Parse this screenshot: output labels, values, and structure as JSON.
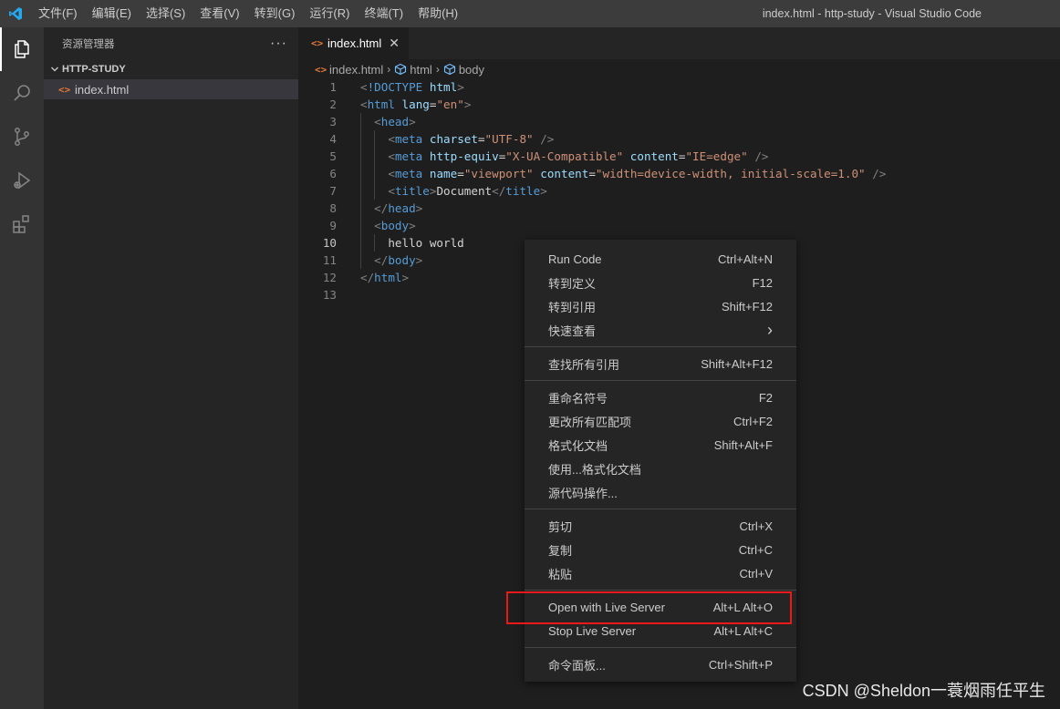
{
  "titlebar": {
    "menu": [
      "文件(F)",
      "编辑(E)",
      "选择(S)",
      "查看(V)",
      "转到(G)",
      "运行(R)",
      "终端(T)",
      "帮助(H)"
    ],
    "window_title": "index.html - http-study - Visual Studio Code"
  },
  "activitybar": {
    "icons": [
      "explorer-icon",
      "search-icon",
      "source-control-icon",
      "run-debug-icon",
      "extensions-icon"
    ]
  },
  "sidebar": {
    "title": "资源管理器",
    "more": "···",
    "folder": "HTTP-STUDY",
    "files": [
      {
        "icon": "<>",
        "name": "index.html"
      }
    ]
  },
  "editor": {
    "tab": {
      "icon": "<>",
      "name": "index.html",
      "close": "✕"
    },
    "breadcrumbs": [
      "index.html",
      "html",
      "body"
    ],
    "line_numbers": [
      "1",
      "2",
      "3",
      "4",
      "5",
      "6",
      "7",
      "8",
      "9",
      "10",
      "11",
      "12",
      "13"
    ],
    "current_line": "10",
    "lines": [
      {
        "indent": 0,
        "tokens": [
          [
            "punc",
            "<"
          ],
          [
            "tag",
            "!DOCTYPE"
          ],
          [
            "text",
            " "
          ],
          [
            "attr",
            "html"
          ],
          [
            "punc",
            ">"
          ]
        ]
      },
      {
        "indent": 0,
        "tokens": [
          [
            "punc",
            "<"
          ],
          [
            "tag",
            "html"
          ],
          [
            "text",
            " "
          ],
          [
            "attr",
            "lang"
          ],
          [
            "text",
            "="
          ],
          [
            "str",
            "\"en\""
          ],
          [
            "punc",
            ">"
          ]
        ]
      },
      {
        "indent": 1,
        "tokens": [
          [
            "punc",
            "<"
          ],
          [
            "tag",
            "head"
          ],
          [
            "punc",
            ">"
          ]
        ]
      },
      {
        "indent": 2,
        "tokens": [
          [
            "punc",
            "<"
          ],
          [
            "tag",
            "meta"
          ],
          [
            "text",
            " "
          ],
          [
            "attr",
            "charset"
          ],
          [
            "text",
            "="
          ],
          [
            "str",
            "\"UTF-8\""
          ],
          [
            "text",
            " "
          ],
          [
            "punc",
            "/>"
          ]
        ]
      },
      {
        "indent": 2,
        "tokens": [
          [
            "punc",
            "<"
          ],
          [
            "tag",
            "meta"
          ],
          [
            "text",
            " "
          ],
          [
            "attr",
            "http-equiv"
          ],
          [
            "text",
            "="
          ],
          [
            "str",
            "\"X-UA-Compatible\""
          ],
          [
            "text",
            " "
          ],
          [
            "attr",
            "content"
          ],
          [
            "text",
            "="
          ],
          [
            "str",
            "\"IE=edge\""
          ],
          [
            "text",
            " "
          ],
          [
            "punc",
            "/>"
          ]
        ]
      },
      {
        "indent": 2,
        "tokens": [
          [
            "punc",
            "<"
          ],
          [
            "tag",
            "meta"
          ],
          [
            "text",
            " "
          ],
          [
            "attr",
            "name"
          ],
          [
            "text",
            "="
          ],
          [
            "str",
            "\"viewport\""
          ],
          [
            "text",
            " "
          ],
          [
            "attr",
            "content"
          ],
          [
            "text",
            "="
          ],
          [
            "str",
            "\"width=device-width, initial-scale=1.0\""
          ],
          [
            "text",
            " "
          ],
          [
            "punc",
            "/>"
          ]
        ]
      },
      {
        "indent": 2,
        "tokens": [
          [
            "punc",
            "<"
          ],
          [
            "tag",
            "title"
          ],
          [
            "punc",
            ">"
          ],
          [
            "text",
            "Document"
          ],
          [
            "punc",
            "</"
          ],
          [
            "tag",
            "title"
          ],
          [
            "punc",
            ">"
          ]
        ]
      },
      {
        "indent": 1,
        "tokens": [
          [
            "punc",
            "</"
          ],
          [
            "tag",
            "head"
          ],
          [
            "punc",
            ">"
          ]
        ]
      },
      {
        "indent": 1,
        "tokens": [
          [
            "punc",
            "<"
          ],
          [
            "tag",
            "body"
          ],
          [
            "punc",
            ">"
          ]
        ]
      },
      {
        "indent": 2,
        "tokens": [
          [
            "text",
            "hello world"
          ]
        ]
      },
      {
        "indent": 1,
        "tokens": [
          [
            "punc",
            "</"
          ],
          [
            "tag",
            "body"
          ],
          [
            "punc",
            ">"
          ]
        ]
      },
      {
        "indent": 0,
        "tokens": [
          [
            "punc",
            "</"
          ],
          [
            "tag",
            "html"
          ],
          [
            "punc",
            ">"
          ]
        ]
      },
      {
        "indent": 0,
        "tokens": []
      }
    ]
  },
  "context_menu": {
    "groups": [
      [
        {
          "label": "Run Code",
          "key": "Ctrl+Alt+N"
        },
        {
          "label": "转到定义",
          "key": "F12"
        },
        {
          "label": "转到引用",
          "key": "Shift+F12"
        },
        {
          "label": "快速查看",
          "key": "›"
        }
      ],
      [
        {
          "label": "查找所有引用",
          "key": "Shift+Alt+F12"
        }
      ],
      [
        {
          "label": "重命名符号",
          "key": "F2"
        },
        {
          "label": "更改所有匹配项",
          "key": "Ctrl+F2"
        },
        {
          "label": "格式化文档",
          "key": "Shift+Alt+F"
        },
        {
          "label": "使用...格式化文档",
          "key": ""
        },
        {
          "label": "源代码操作...",
          "key": ""
        }
      ],
      [
        {
          "label": "剪切",
          "key": "Ctrl+X"
        },
        {
          "label": "复制",
          "key": "Ctrl+C"
        },
        {
          "label": "粘贴",
          "key": "Ctrl+V"
        }
      ],
      [
        {
          "label": "Open with Live Server",
          "key": "Alt+L Alt+O"
        },
        {
          "label": "Stop Live Server",
          "key": "Alt+L Alt+C"
        }
      ],
      [
        {
          "label": "命令面板...",
          "key": "Ctrl+Shift+P"
        }
      ]
    ],
    "highlighted": "Open with Live Server"
  },
  "colors": {
    "highlight_border": "#e8191b",
    "html_icon": "#e37933",
    "vscode_blue": "#23a9f2"
  },
  "watermark": "CSDN @Sheldon一蓑烟雨任平生"
}
